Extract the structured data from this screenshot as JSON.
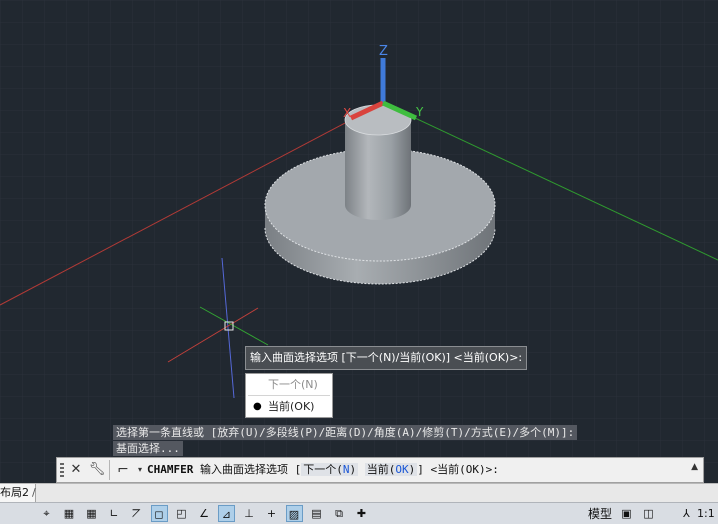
{
  "viewport": {
    "axis_labels": {
      "z": "Z",
      "x": "X",
      "y": "Y"
    },
    "colors": {
      "background": "#212830",
      "grid": "#2f3640",
      "x_axis": "#d9433d",
      "y_axis": "#3fbd3f",
      "z_axis": "#3f7ad9",
      "model": "#a9adb2"
    }
  },
  "dynamic_input": {
    "prompt": "输入曲面选择选项 [下一个(N)/当前(OK)] <当前(OK)>:",
    "menu": [
      {
        "label": "下一个(N)",
        "state": "disabled"
      },
      {
        "label": "当前(OK)",
        "state": "checked"
      }
    ]
  },
  "command_history": [
    "选择第一条直线或 [放弃(U)/多段线(P)/距离(D)/角度(A)/修剪(T)/方式(E)/多个(M)]:",
    "基面选择..."
  ],
  "command_line": {
    "command": "CHAMFER",
    "prompt": "输入曲面选择选项",
    "bracket_open": "[",
    "option1_text": "下一个(",
    "option1_key": "N",
    "option1_close": ")",
    "option2_text": "当前(",
    "option2_key": "OK",
    "option2_close": ")",
    "bracket_close": "]",
    "default": "<当前(OK)>:"
  },
  "tabs": {
    "layout2": "布局2",
    "separator": "/"
  },
  "status_bar": {
    "model": "模型",
    "scale": "1:1",
    "buttons": [
      {
        "name": "snap-mode-button",
        "glyph": "⌖",
        "on": false
      },
      {
        "name": "grid-display-button",
        "glyph": "▦",
        "on": false
      },
      {
        "name": "grid-button",
        "glyph": "▦",
        "on": false
      },
      {
        "name": "ortho-mode-button",
        "glyph": "∟",
        "on": false
      },
      {
        "name": "polar-tracking-button",
        "glyph": "⦢",
        "on": false
      },
      {
        "name": "isodraft-button",
        "glyph": "◻",
        "on": true
      },
      {
        "name": "object-snap-tracking-button",
        "glyph": "◰",
        "on": false
      },
      {
        "name": "object-snap-button",
        "glyph": "∠",
        "on": false
      },
      {
        "name": "3d-osnap-button",
        "glyph": "⊿",
        "on": true
      },
      {
        "name": "dynamic-ucs-button",
        "glyph": "⊥",
        "on": false
      },
      {
        "name": "dynamic-input-button",
        "glyph": "+",
        "on": false
      },
      {
        "name": "lineweight-button",
        "glyph": "▨",
        "on": true
      },
      {
        "name": "transparency-button",
        "glyph": "▤",
        "on": false
      },
      {
        "name": "selection-cycling-button",
        "glyph": "⧉",
        "on": false
      },
      {
        "name": "annotation-monitor-button",
        "glyph": "✚",
        "on": false
      }
    ]
  }
}
